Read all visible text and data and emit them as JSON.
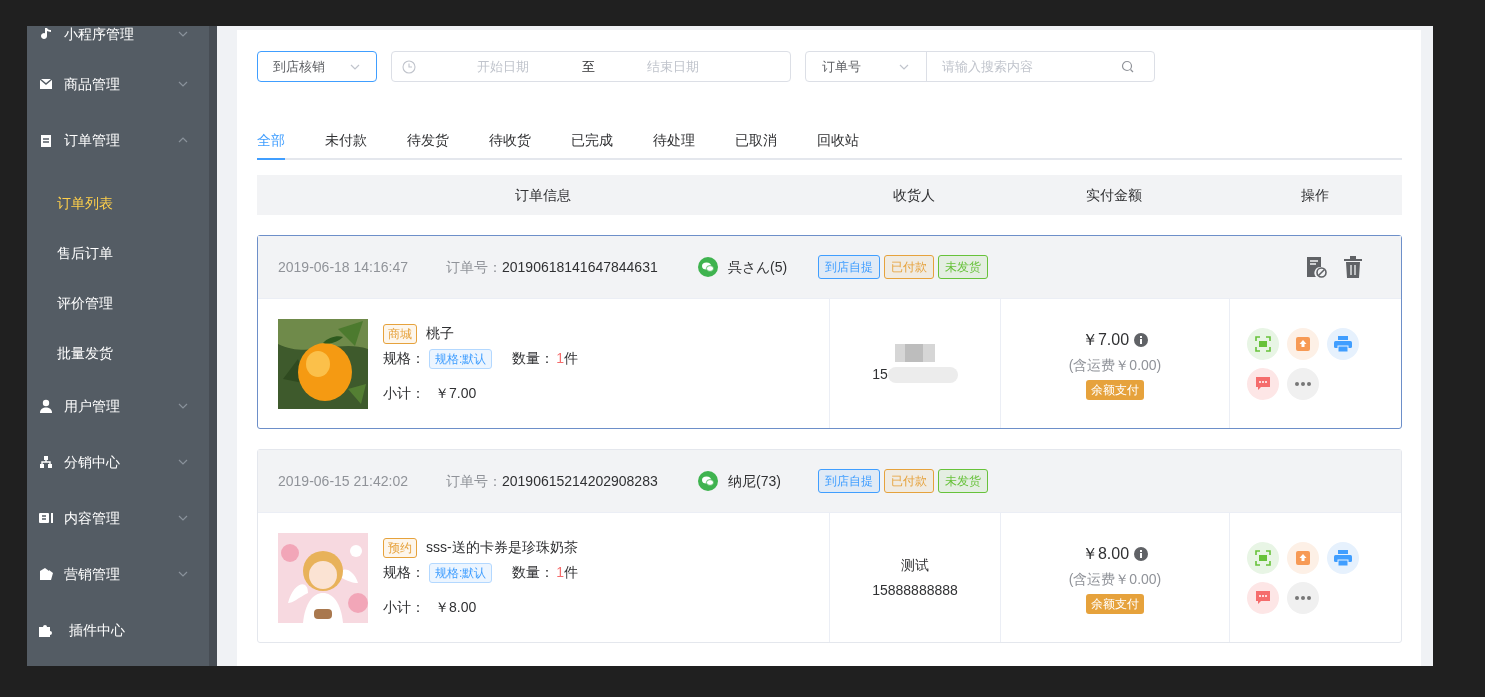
{
  "sidebar": {
    "items": [
      {
        "label": "小程序管理",
        "kind": "group",
        "expanded": false
      },
      {
        "label": "商品管理",
        "kind": "group",
        "expanded": false
      },
      {
        "label": "订单管理",
        "kind": "group",
        "expanded": true,
        "children": [
          {
            "label": "订单列表",
            "selected": true
          },
          {
            "label": "售后订单",
            "selected": false
          },
          {
            "label": "评价管理",
            "selected": false
          },
          {
            "label": "批量发货",
            "selected": false
          }
        ]
      },
      {
        "label": "用户管理",
        "kind": "group",
        "expanded": false
      },
      {
        "label": "分销中心",
        "kind": "group",
        "expanded": false
      },
      {
        "label": "内容管理",
        "kind": "group",
        "expanded": false
      },
      {
        "label": "营销管理",
        "kind": "group",
        "expanded": false
      },
      {
        "label": "插件中心",
        "kind": "link"
      }
    ]
  },
  "filters": {
    "status_select": {
      "value": "到店核销"
    },
    "date_range": {
      "start_placeholder": "开始日期",
      "separator": "至",
      "end_placeholder": "结束日期"
    },
    "search": {
      "field_select": "订单号",
      "placeholder": "请输入搜索内容"
    }
  },
  "tabs": [
    {
      "label": "全部",
      "selected": true
    },
    {
      "label": "未付款",
      "selected": false
    },
    {
      "label": "待发货",
      "selected": false
    },
    {
      "label": "待收货",
      "selected": false
    },
    {
      "label": "已完成",
      "selected": false
    },
    {
      "label": "待处理",
      "selected": false
    },
    {
      "label": "已取消",
      "selected": false
    },
    {
      "label": "回收站",
      "selected": false
    }
  ],
  "table": {
    "columns": [
      "订单信息",
      "收货人",
      "实付金额",
      "操作"
    ]
  },
  "orders": [
    {
      "time": "2019-06-18 14:16:47",
      "order_no_label": "订单号：",
      "order_no": "20190618141647844631",
      "buyer": "呉さん(5)",
      "highlighted": true,
      "show_actions": true,
      "tags": [
        {
          "label": "到店自提",
          "color": "#409eff"
        },
        {
          "label": "已付款",
          "color": "#e6a23c"
        },
        {
          "label": "未发货",
          "color": "#67c23a"
        }
      ],
      "product": {
        "source_tag": "商城",
        "name": "桃子",
        "spec_label": "规格：",
        "spec": "规格:默认",
        "qty_label": "数量：",
        "qty": "1",
        "qty_unit": "件",
        "subtotal_label": "小计：",
        "subtotal": "￥7.00"
      },
      "receiver": {
        "phone": "15",
        "blurred": true
      },
      "amount": {
        "total": "￥7.00",
        "shipping": "(含运费￥0.00)",
        "payment": "余额支付"
      }
    },
    {
      "time": "2019-06-15 21:42:02",
      "order_no_label": "订单号：",
      "order_no": "20190615214202908283",
      "buyer": "纳尼(73)",
      "highlighted": false,
      "show_actions": false,
      "tags": [
        {
          "label": "到店自提",
          "color": "#409eff"
        },
        {
          "label": "已付款",
          "color": "#e6a23c"
        },
        {
          "label": "未发货",
          "color": "#67c23a"
        }
      ],
      "product": {
        "source_tag": "预约",
        "name": "sss-送的卡券是珍珠奶茶",
        "spec_label": "规格：",
        "spec": "规格:默认",
        "qty_label": "数量：",
        "qty": "1",
        "qty_unit": "件",
        "subtotal_label": "小计：",
        "subtotal": "￥8.00"
      },
      "receiver": {
        "name": "测试",
        "phone": "15888888888",
        "blurred": false
      },
      "amount": {
        "total": "￥8.00",
        "shipping": "(含运费￥0.00)",
        "payment": "余额支付"
      }
    }
  ]
}
